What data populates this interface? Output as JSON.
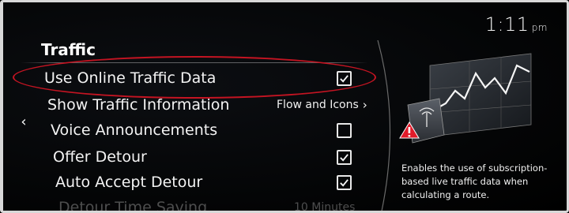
{
  "status_bar": {
    "time": "1:11",
    "ampm": "pm"
  },
  "section": {
    "title": "Traffic"
  },
  "navigation": {
    "back_glyph": "‹"
  },
  "settings": [
    {
      "label": "Use Online Traffic Data",
      "control": "checkbox",
      "checked": true,
      "highlighted": true
    },
    {
      "label": "Show Traffic Information",
      "control": "value",
      "value": "Flow and Icons",
      "chevron": "›"
    },
    {
      "label": "Voice Announcements",
      "control": "checkbox",
      "checked": false
    },
    {
      "label": "Offer Detour",
      "control": "checkbox",
      "checked": true
    },
    {
      "label": "Auto Accept Detour",
      "control": "checkbox",
      "checked": true
    },
    {
      "label": "Detour Time Saving",
      "control": "value",
      "value": "10 Minutes",
      "faded": true
    }
  ],
  "help_panel": {
    "illustration_icon": "traffic-chart-with-warning-icon",
    "description": "Enables the use of subscription-based live traffic data when calculating a route."
  },
  "colors": {
    "highlight_ring": "#c41422",
    "warning_red": "#e11b2a",
    "text": "#f2f2f2"
  }
}
